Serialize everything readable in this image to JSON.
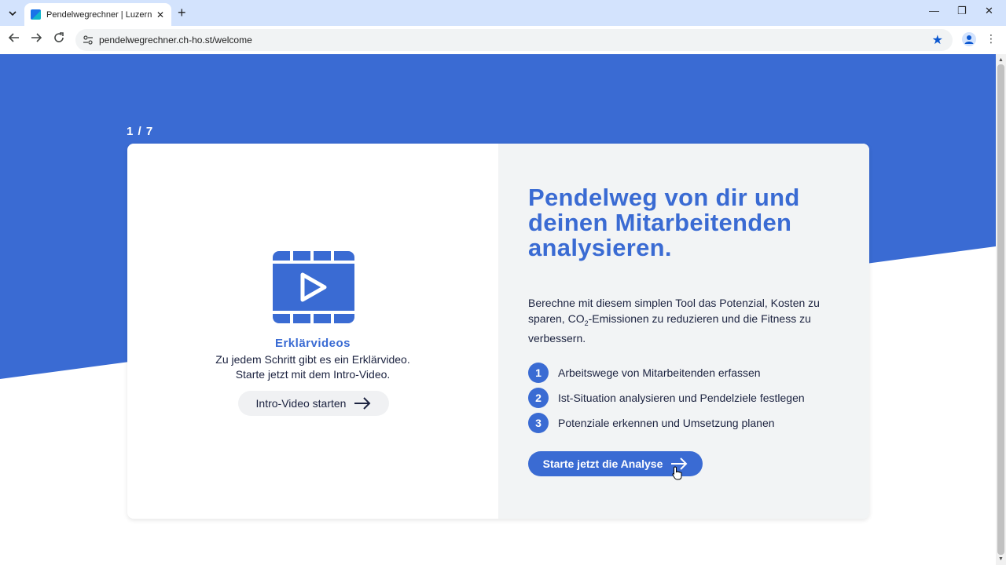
{
  "browser": {
    "tab_title": "Pendelwegrechner | Luzernmobil",
    "tab_close": "✕",
    "new_tab": "+",
    "url": "pendelwegrechner.ch-ho.st/welcome",
    "icons": [
      "tab-search-icon",
      "favicon",
      "back-arrow-icon",
      "forward-arrow-icon",
      "reload-icon",
      "site-info-icon",
      "bookmark-star-icon",
      "profile-icon",
      "menu-icon"
    ]
  },
  "window_controls": {
    "minimize": "—",
    "restore": "❐",
    "close": "✕"
  },
  "page": {
    "step_counter": "1 / 7",
    "brand_color": "#3a6bd3",
    "video": {
      "title": "Erklärvideos",
      "line1": "Zu jedem Schritt gibt es ein Erklärvideo.",
      "line2": "Starte jetzt mit dem Intro-Video.",
      "button_label": "Intro-Video starten"
    },
    "headline": "Pendelweg von dir und deinen Mitarbeitenden analysieren.",
    "description": {
      "part1": "Berechne mit diesem simplen Tool das Potenzial, Kosten zu sparen, CO",
      "sub": "2",
      "part2": "-Emissionen zu reduzieren und die Fitness zu verbessern."
    },
    "steps": [
      {
        "num": "1",
        "text": "Arbeitswege von Mitarbeitenden erfassen"
      },
      {
        "num": "2",
        "text": "Ist-Situation analysieren und Pendelziele festlegen"
      },
      {
        "num": "3",
        "text": "Potenziale erkennen und Umsetzung planen"
      }
    ],
    "cta_label": "Starte jetzt die Analyse"
  }
}
